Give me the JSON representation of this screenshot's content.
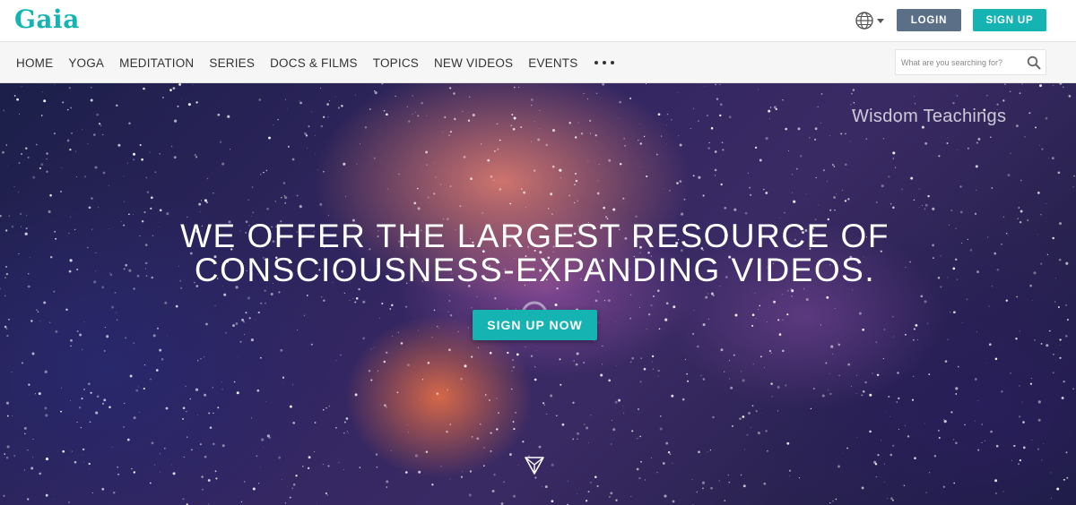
{
  "brand": {
    "logo": "Gaia",
    "accent": "#16b3b3",
    "login_color": "#5b6f86"
  },
  "header": {
    "language_icon": "globe-icon",
    "login_label": "LOGIN",
    "signup_label": "SIGN UP"
  },
  "nav": {
    "items": [
      {
        "label": "HOME"
      },
      {
        "label": "YOGA"
      },
      {
        "label": "MEDITATION"
      },
      {
        "label": "SERIES"
      },
      {
        "label": "DOCS & FILMS"
      },
      {
        "label": "TOPICS"
      },
      {
        "label": "NEW VIDEOS"
      },
      {
        "label": "EVENTS"
      }
    ],
    "more_icon": "more-dots-icon",
    "search_placeholder": "What are you searching for?"
  },
  "hero": {
    "label": "Wisdom Teachings",
    "headline_line1": "WE OFFER THE LARGEST RESOURCE OF",
    "headline_line2": "CONSCIOUSNESS-EXPANDING VIDEOS.",
    "cta_label": "SIGN UP NOW",
    "loading_icon": "loading-spinner-icon",
    "scroll_icon": "scroll-down-icon"
  }
}
